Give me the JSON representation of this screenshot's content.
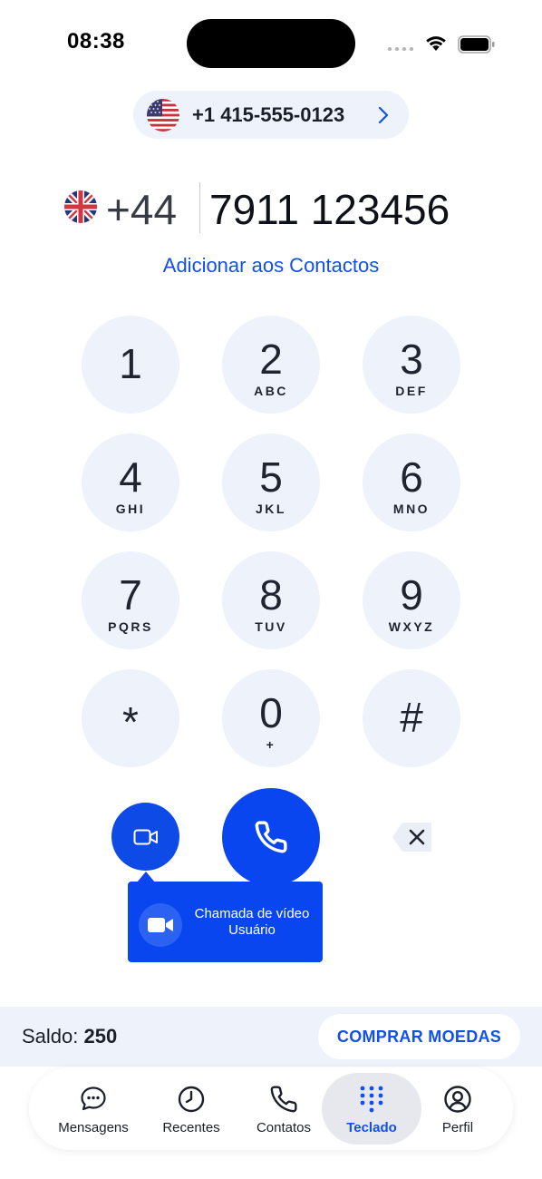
{
  "status_bar": {
    "time": "08:38"
  },
  "caller_id": {
    "number": "+1 415-555-0123"
  },
  "dialer": {
    "country_code": "+44",
    "number": "7911 123456",
    "add_contact_label": "Adicionar aos Contactos"
  },
  "keypad": {
    "k1": {
      "digit": "1",
      "letters": ""
    },
    "k2": {
      "digit": "2",
      "letters": "ABC"
    },
    "k3": {
      "digit": "3",
      "letters": "DEF"
    },
    "k4": {
      "digit": "4",
      "letters": "GHI"
    },
    "k5": {
      "digit": "5",
      "letters": "JKL"
    },
    "k6": {
      "digit": "6",
      "letters": "MNO"
    },
    "k7": {
      "digit": "7",
      "letters": "PQRS"
    },
    "k8": {
      "digit": "8",
      "letters": "TUV"
    },
    "k9": {
      "digit": "9",
      "letters": "WXYZ"
    },
    "kstar": {
      "digit": "*",
      "letters": ""
    },
    "k0": {
      "digit": "0",
      "letters": "+"
    },
    "khash": {
      "digit": "#",
      "letters": ""
    }
  },
  "tooltip": {
    "line1": "Chamada de vídeo",
    "line2": "Usuário"
  },
  "balance": {
    "label": "Saldo:",
    "value": "250",
    "buy_label": "COMPRAR MOEDAS"
  },
  "tabs": {
    "messages": "Mensagens",
    "recents": "Recentes",
    "contacts": "Contatos",
    "keypad": "Teclado",
    "profile": "Perfil"
  },
  "colors": {
    "accent": "#0a46f0",
    "link": "#1350e8",
    "key_background": "#edf2fb"
  },
  "icons": {
    "caller_flag": "us-flag-icon",
    "dial_flag": "uk-flag-icon",
    "video": "video-camera-icon",
    "call": "phone-icon",
    "delete": "backspace-icon"
  }
}
